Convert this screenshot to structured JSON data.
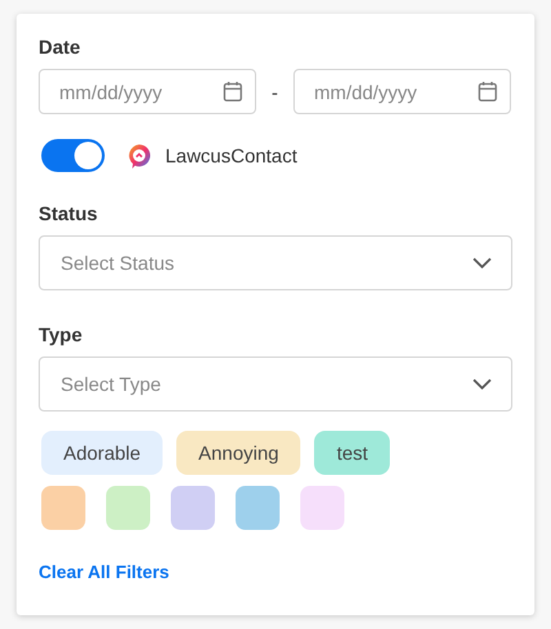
{
  "date": {
    "label": "Date",
    "from": {
      "placeholder": "mm/dd/yyyy"
    },
    "separator": "-",
    "to": {
      "placeholder": "mm/dd/yyyy"
    }
  },
  "source_toggle": {
    "on": true,
    "label": "LawcusContact"
  },
  "status": {
    "label": "Status",
    "placeholder": "Select Status"
  },
  "type": {
    "label": "Type",
    "placeholder": "Select Type"
  },
  "tags": [
    {
      "label": "Adorable",
      "color": "#e3effd"
    },
    {
      "label": "Annoying",
      "color": "#f9e8c2"
    },
    {
      "label": "test",
      "color": "#9ee9d9"
    }
  ],
  "color_swatches": [
    {
      "color": "#fbd0a5"
    },
    {
      "color": "#cdf0c5"
    },
    {
      "color": "#d0cff4"
    },
    {
      "color": "#9ed0ec"
    },
    {
      "color": "#f6dffb"
    }
  ],
  "clear_link": "Clear All Filters"
}
